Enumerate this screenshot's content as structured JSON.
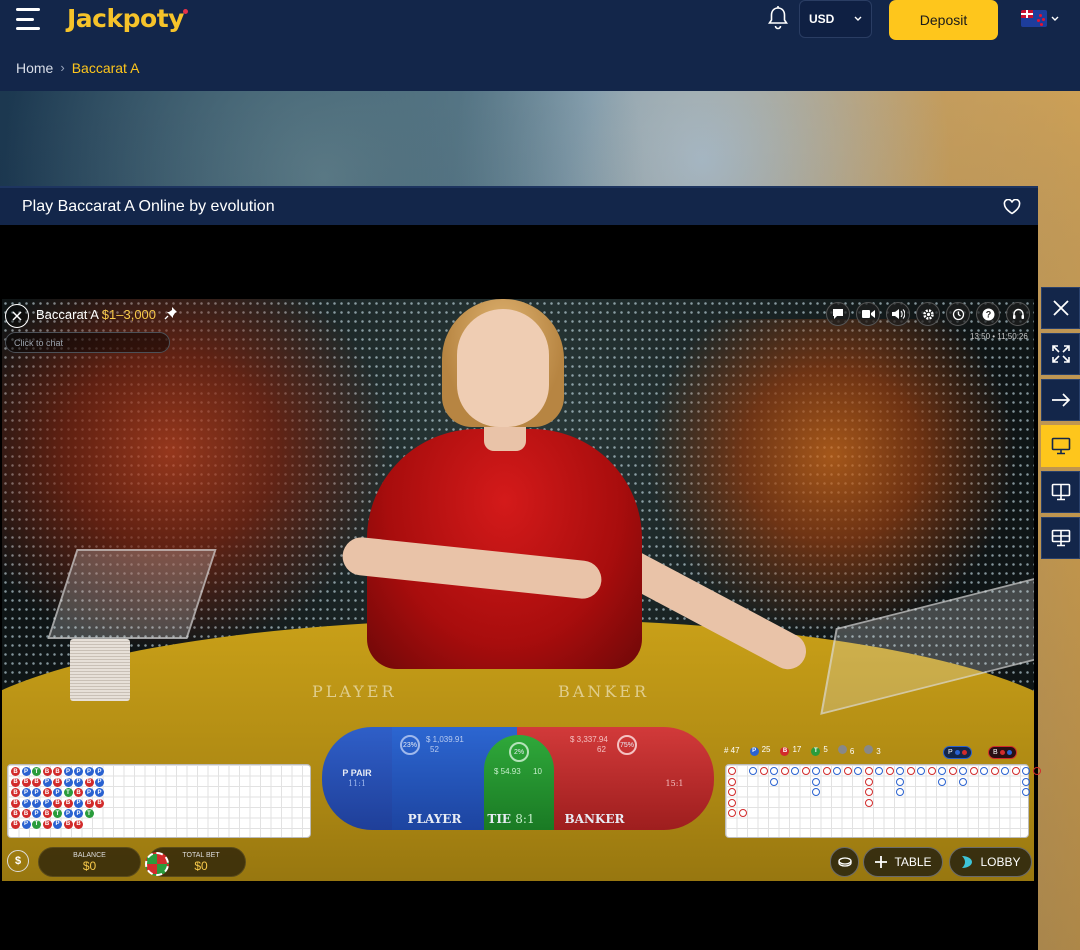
{
  "header": {
    "logo": "Jackpoty",
    "currency": "USD",
    "deposit_label": "Deposit"
  },
  "breadcrumb": {
    "home": "Home",
    "current": "Baccarat A"
  },
  "game": {
    "title": "Play Baccarat A Online by evolution",
    "table_name": "Baccarat A",
    "limits": "$1–3,000",
    "chat_placeholder": "Click to chat",
    "clock": "13:50 • 11:50:26",
    "felt_player": "PLAYER",
    "felt_banker": "BANKER"
  },
  "bets": {
    "player_pair": {
      "label": "P PAIR",
      "odds": "11:1"
    },
    "player": {
      "label": "PLAYER",
      "pct": "23%",
      "amount": "$ 1,039.91",
      "count": "52"
    },
    "tie": {
      "label": "TIE",
      "odds": "8:1",
      "pct": "2%",
      "amount": "$ 54.93",
      "count": "10"
    },
    "banker": {
      "label": "BANKER",
      "pct": "75%",
      "amount": "$ 3,337.94",
      "count": "62"
    },
    "banker_pair": {
      "odds": "15:1"
    }
  },
  "stats": {
    "rounds": "# 47",
    "player": "25",
    "banker": "17",
    "tie": "5",
    "p_pair": "6",
    "b_pair": "3",
    "player_ask": "P",
    "banker_ask": "B"
  },
  "bead_road": [
    [
      "B",
      "B",
      "B",
      "B",
      "B",
      "B"
    ],
    [
      "P",
      "B",
      "P",
      "P",
      "B",
      "P"
    ],
    [
      "T",
      "B",
      "P",
      "P",
      "P",
      "T"
    ],
    [
      "B",
      "P",
      "B",
      "P",
      "B",
      "B"
    ],
    [
      "B",
      "B",
      "P",
      "B",
      "T",
      "P"
    ],
    [
      "P",
      "P",
      "T",
      "B",
      "P",
      "B"
    ],
    [
      "P",
      "P",
      "B",
      "P",
      "P",
      "B"
    ],
    [
      "P",
      "B",
      "P",
      "B",
      "T",
      ""
    ],
    [
      "P",
      "P",
      "P",
      "B",
      "",
      ""
    ]
  ],
  "footer": {
    "balance_label": "BALANCE",
    "balance_value": "$0",
    "total_bet_label": "TOTAL BET",
    "total_bet_value": "$0",
    "table_label": "TABLE",
    "lobby_label": "LOBBY"
  },
  "colors": {
    "accent": "#fec61c",
    "nav_bg": "#13264a",
    "player_blue": "#2a62d1",
    "banker_red": "#d22b2b",
    "tie_green": "#2a9c3c"
  }
}
